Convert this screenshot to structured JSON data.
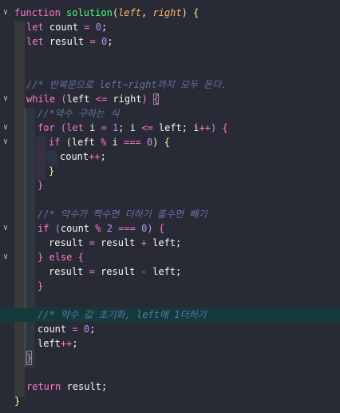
{
  "editor": {
    "lines": {
      "l1": {
        "fn_kw": "function",
        "fn_name": "solution",
        "p_open": "(",
        "param1": "left",
        "comma": ",",
        "param2": "right",
        "p_close": ")",
        "brace": "{"
      },
      "l2": {
        "kw": "let",
        "name": "count",
        "eq": "=",
        "val": "0",
        "semi": ";"
      },
      "l3": {
        "kw": "let",
        "name": "result",
        "eq": "=",
        "val": "0",
        "semi": ";"
      },
      "l6": {
        "comment": "//* 반복문으로 left~right까지 모두 돈다."
      },
      "l7": {
        "kw": "while",
        "p_open": "(",
        "a": "left",
        "op": "<=",
        "b": "right",
        "p_close": ")",
        "brace": "{"
      },
      "l8": {
        "comment": "//*약수 구하는 식"
      },
      "l9": {
        "kw": "for",
        "p_open": "(",
        "let_kw": "let",
        "i1": "i",
        "eq": "=",
        "one": "1",
        "semi1": ";",
        "i2": "i",
        "le": "<=",
        "left": "left",
        "semi2": ";",
        "i3": "i",
        "inc": "++",
        "p_close": ")",
        "brace": "{"
      },
      "l10": {
        "kw": "if",
        "p_open": "(",
        "left": "left",
        "mod": "%",
        "i": "i",
        "seq": "===",
        "zero": "0",
        "p_close": ")",
        "brace": "{"
      },
      "l11": {
        "name": "count",
        "inc": "++",
        "semi": ";"
      },
      "l12": {
        "brace": "}"
      },
      "l13": {
        "brace": "}"
      },
      "l15": {
        "comment": "//* 약수가 짝수면 더하기 홀수면 빼기"
      },
      "l16": {
        "kw": "if",
        "p_open": "(",
        "count": "count",
        "mod": "%",
        "two": "2",
        "seq": "===",
        "zero": "0",
        "p_close": ")",
        "brace": "{"
      },
      "l17": {
        "a": "result",
        "eq": "=",
        "b": "result",
        "plus": "+",
        "c": "left",
        "semi": ";"
      },
      "l18": {
        "brace_close": "}",
        "kw": "else",
        "brace": "{"
      },
      "l19": {
        "a": "result",
        "eq": "=",
        "b": "result",
        "minus": "-",
        "c": "left",
        "semi": ";"
      },
      "l20": {
        "brace": "}"
      },
      "l22": {
        "comment": "//* 약수 값 초기화, left에 1더하기"
      },
      "l23": {
        "name": "count",
        "eq": "=",
        "val": "0",
        "semi": ";"
      },
      "l24": {
        "name": "left",
        "inc": "++",
        "semi": ";"
      },
      "l25": {
        "brace": "}"
      },
      "l27": {
        "kw": "return",
        "name": "result",
        "semi": ";"
      },
      "l28": {
        "brace": "}"
      }
    },
    "fold_icon": "chevron-down-icon"
  }
}
